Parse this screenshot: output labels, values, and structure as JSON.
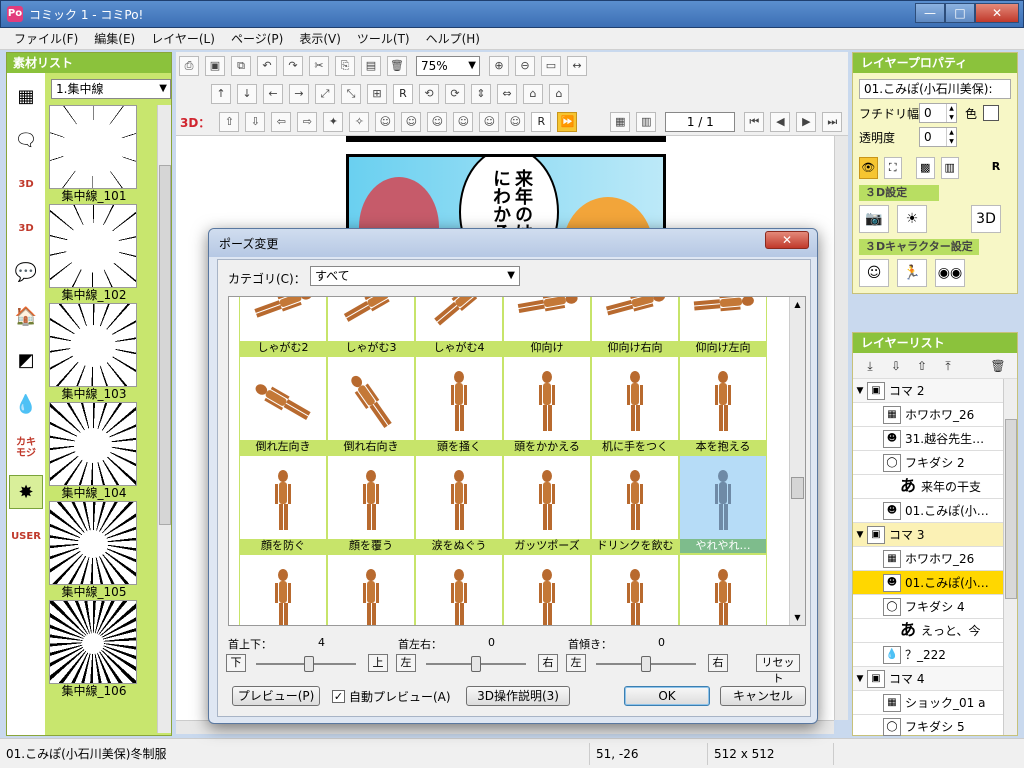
{
  "window": {
    "title": "コミック 1 - コミPo!",
    "app_icon": "Po",
    "minimize": "—",
    "maximize": "□",
    "close": "✕"
  },
  "menu": [
    "ファイル(F)",
    "編集(E)",
    "レイヤー(L)",
    "ページ(P)",
    "表示(V)",
    "ツール(T)",
    "ヘルプ(H)"
  ],
  "asset_panel": {
    "title": "素材リスト",
    "select_value": "1.集中線",
    "items": [
      "集中線_101",
      "集中線_102",
      "集中線_103",
      "集中線_104",
      "集中線_105",
      "集中線_106"
    ],
    "category_icons": [
      "background-icon",
      "speech-card-icon",
      "3d-character-icon",
      "3d-cube-icon",
      "speech-bubble-icon",
      "image-icon",
      "3d-object-icon",
      "drop-icon",
      "katakana-moji-icon",
      "effect-icon",
      "user-icon"
    ],
    "category_labels": [
      "",
      "",
      "3D",
      "3D",
      "",
      "",
      "",
      "",
      "カキ\nモジ",
      "",
      "USER"
    ]
  },
  "toolbar": {
    "zoom": "75%",
    "label_3d": "3D：",
    "page": "1 / 1"
  },
  "canvas": {
    "bubble_text": "来年のはなにわかる"
  },
  "properties": {
    "title": "レイヤープロパティ",
    "name": "01.こみぽ(小石川美保):",
    "outline_label": "フチドリ幅",
    "outline_value": "0",
    "color_label": "色",
    "opacity_label": "透明度",
    "opacity_value": "0",
    "section_3d": "３D設定",
    "section_3d_char": "３Dキャラクター設定"
  },
  "layers": {
    "title": "レイヤーリスト",
    "rows": [
      {
        "indent": 0,
        "type": "group",
        "icon": "koma-icon",
        "label": "コマ 2",
        "expanded": true
      },
      {
        "indent": 1,
        "type": "item",
        "icon": "effect-layer-icon",
        "label": "ホワホワ_26"
      },
      {
        "indent": 1,
        "type": "item",
        "icon": "character-icon",
        "label": "31.越谷先生…"
      },
      {
        "indent": 1,
        "type": "item",
        "icon": "bubble-layer-icon",
        "label": "フキダシ 2"
      },
      {
        "indent": 2,
        "type": "item",
        "icon": "text-layer-icon",
        "label": "来年の干支"
      },
      {
        "indent": 1,
        "type": "item",
        "icon": "character-icon",
        "label": "01.こみぽ(小…"
      },
      {
        "indent": 0,
        "type": "group",
        "icon": "koma-icon",
        "label": "コマ 3",
        "expanded": true,
        "highlight": true
      },
      {
        "indent": 1,
        "type": "item",
        "icon": "effect-layer-icon",
        "label": "ホワホワ_26"
      },
      {
        "indent": 1,
        "type": "item",
        "icon": "character-icon",
        "label": "01.こみぽ(小…",
        "selected": true
      },
      {
        "indent": 1,
        "type": "item",
        "icon": "bubble-layer-icon",
        "label": "フキダシ 4"
      },
      {
        "indent": 2,
        "type": "item",
        "icon": "text-layer-icon",
        "label": "えっと、今"
      },
      {
        "indent": 1,
        "type": "item",
        "icon": "drop-layer-icon",
        "label": "？_222"
      },
      {
        "indent": 0,
        "type": "group",
        "icon": "koma-icon",
        "label": "コマ 4",
        "expanded": true
      },
      {
        "indent": 1,
        "type": "item",
        "icon": "effect-layer-icon",
        "label": "ショック_01 a"
      },
      {
        "indent": 1,
        "type": "item",
        "icon": "bubble-layer-icon",
        "label": "フキダシ 5"
      }
    ]
  },
  "status": {
    "name": "01.こみぽ(小石川美保)冬制服",
    "coords": "51, -26",
    "size": "512 x 512"
  },
  "dialog": {
    "title": "ポーズ変更",
    "close": "✕",
    "category_label": "カテゴリ(C)：",
    "category_value": "すべて",
    "poses": [
      "しゃがむ2",
      "しゃがむ3",
      "しゃがむ4",
      "仰向け",
      "仰向け右向",
      "仰向け左向",
      "倒れ左向き",
      "倒れ右向き",
      "頭を掻く",
      "頭をかかえる",
      "机に手をつく",
      "本を抱える",
      "顔を防ぐ",
      "顔を覆う",
      "涙をぬぐう",
      "ガッツポーズ",
      "ドリンクを飲む",
      "やれやれ…",
      "",
      "",
      "",
      "",
      "",
      ""
    ],
    "selected_index": 17,
    "controls": [
      {
        "label": "首上下：",
        "value": "4",
        "left": "下",
        "right": "上",
        "fraction": 0.53
      },
      {
        "label": "首左右：",
        "value": "0",
        "left": "左",
        "right": "右",
        "fraction": 0.5
      },
      {
        "label": "首傾き：",
        "value": "0",
        "left": "左",
        "right": "右",
        "fraction": 0.5
      }
    ],
    "reset": "リセット",
    "preview": "プレビュー(P)",
    "auto_preview": "自動プレビュー(A)",
    "auto_preview_checked": true,
    "help_3d": "3D操作説明(3)",
    "ok": "OK",
    "cancel": "キャンセル"
  }
}
